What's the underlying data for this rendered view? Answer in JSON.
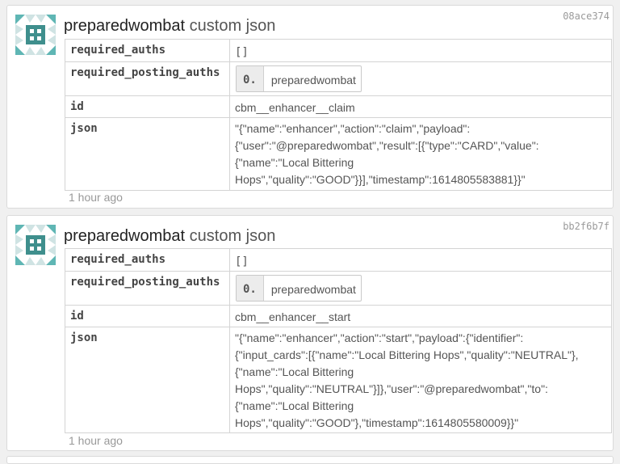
{
  "posts": [
    {
      "txid": "08ace374",
      "user": "preparedwombat",
      "op_type": "custom json",
      "required_auths_key": "required_auths",
      "required_auths_val": "[]",
      "required_posting_auths_key": "required_posting_auths",
      "posting_index": "0.",
      "posting_user": "preparedwombat",
      "id_key": "id",
      "id_val": "cbm__enhancer__claim",
      "json_key": "json",
      "json_val": "\"{\"name\":\"enhancer\",\"action\":\"claim\",\"payload\":{\"user\":\"@preparedwombat\",\"result\":[{\"type\":\"CARD\",\"value\":{\"name\":\"Local Bittering Hops\",\"quality\":\"GOOD\"}}],\"timestamp\":1614805583881}}\"",
      "time": "1 hour ago"
    },
    {
      "txid": "bb2f6b7f",
      "user": "preparedwombat",
      "op_type": "custom json",
      "required_auths_key": "required_auths",
      "required_auths_val": "[]",
      "required_posting_auths_key": "required_posting_auths",
      "posting_index": "0.",
      "posting_user": "preparedwombat",
      "id_key": "id",
      "id_val": "cbm__enhancer__start",
      "json_key": "json",
      "json_val": "\"{\"name\":\"enhancer\",\"action\":\"start\",\"payload\":{\"identifier\":{\"input_cards\":[{\"name\":\"Local Bittering Hops\",\"quality\":\"NEUTRAL\"},{\"name\":\"Local Bittering Hops\",\"quality\":\"NEUTRAL\"}]},\"user\":\"@preparedwombat\",\"to\":{\"name\":\"Local Bittering Hops\",\"quality\":\"GOOD\"},\"timestamp\":1614805580009}}\"",
      "time": "1 hour ago"
    }
  ],
  "colors": {
    "avatar_teal": "#5fb6b4",
    "avatar_light": "#cfe3e3",
    "avatar_dark": "#3f8f8d"
  }
}
